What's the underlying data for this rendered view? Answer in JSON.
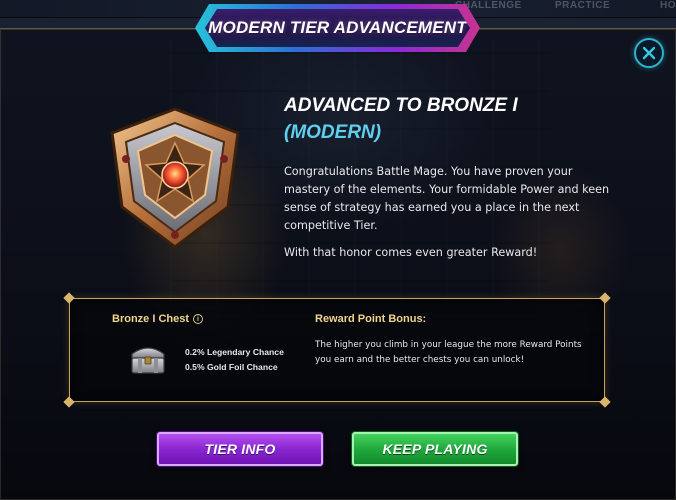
{
  "nav": {
    "challenge_label": "CHALLENGE",
    "practice_label": "PRACTICE",
    "extra_label": "HO"
  },
  "modal": {
    "title": "MODERN TIER ADVANCEMENT",
    "close_icon": "close-icon",
    "emblem_icon": "bronze-tier-shield-icon",
    "headline_line1": "ADVANCED TO BRONZE I",
    "headline_line2": "(MODERN)",
    "message": "Congratulations Battle Mage. You have proven your mastery of the elements. Your formidable Power and keen sense of strategy has earned you a place in the next competitive Tier.",
    "message2": "With that honor comes even greater Reward!"
  },
  "reward": {
    "chest_title": "Bronze I Chest",
    "info_icon_glyph": "i",
    "chest_icon": "treasure-chest-icon",
    "chances": [
      "0.2% Legendary Chance",
      "0.5% Gold Foil Chance"
    ],
    "bonus_title": "Reward Point Bonus:",
    "bonus_text": "The higher you climb in your league the more Reward Points you earn and the better chests you can unlock!"
  },
  "buttons": {
    "tier_info": "TIER INFO",
    "keep_playing": "KEEP PLAYING"
  },
  "colors": {
    "accent_cyan": "#5ed0ee",
    "gold": "#c9a35a",
    "purple": "#8a26d1",
    "green": "#20a93c"
  }
}
